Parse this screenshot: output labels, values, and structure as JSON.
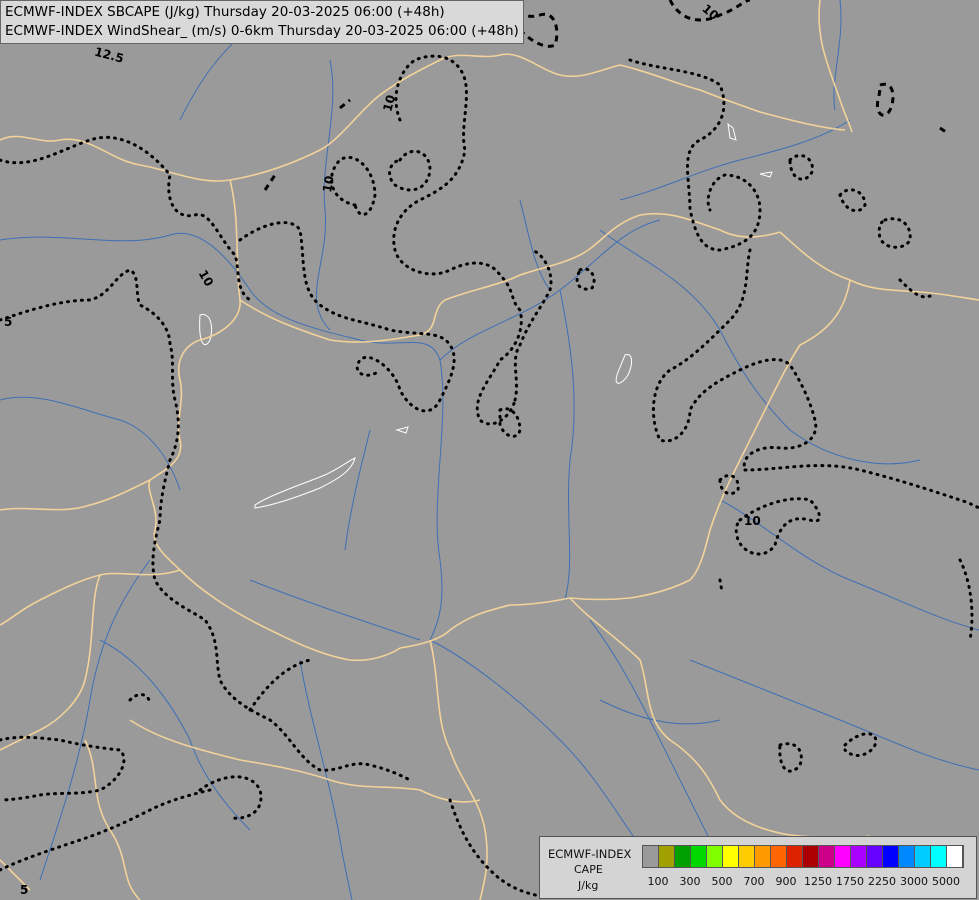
{
  "header": {
    "line1": "ECMWF-INDEX SBCAPE (J/kg) Thursday 20-03-2025 06:00 (+48h)",
    "line2": "ECMWF-INDEX WindShear_ (m/s) 0-6km Thursday 20-03-2025 06:00 (+48h)"
  },
  "map": {
    "background_color": "#9a9a9a",
    "border_color": "#f2d29b",
    "river_color": "#3f6fb5",
    "contour_color": "#000000",
    "contour_labels": [
      "12.5",
      "10",
      "10",
      "10",
      "10",
      "10",
      "10",
      "5",
      "5"
    ]
  },
  "legend": {
    "name": "ECMWF-INDEX",
    "variable": "CAPE",
    "unit": "J/kg",
    "colors": [
      "#9a9a9a",
      "#a0a000",
      "#00a000",
      "#00d800",
      "#80ff00",
      "#ffff00",
      "#ffcc00",
      "#ff9900",
      "#ff6600",
      "#dd2200",
      "#aa0000",
      "#cc0088",
      "#ff00ff",
      "#aa00ff",
      "#6600ff",
      "#0000ff",
      "#0088ff",
      "#00ccff",
      "#00ffff",
      "#ffffff"
    ],
    "tick_labels": [
      "100",
      "300",
      "500",
      "700",
      "900",
      "1250",
      "1750",
      "2250",
      "3000",
      "5000"
    ]
  }
}
